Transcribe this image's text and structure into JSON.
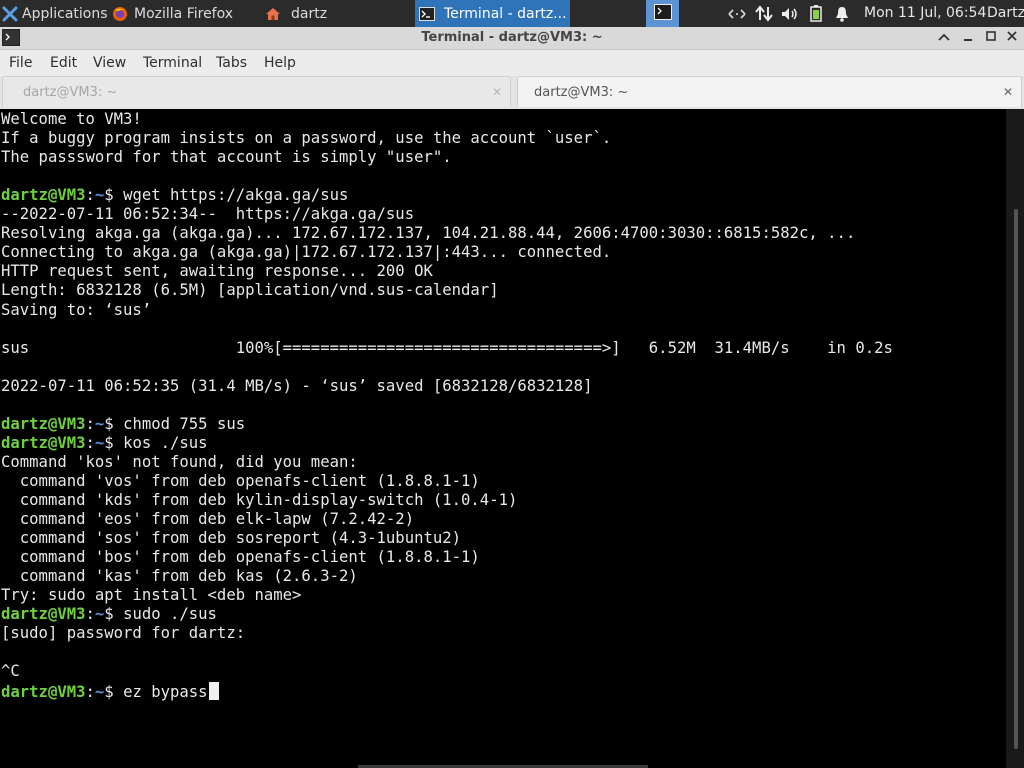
{
  "panel": {
    "applications_label": "Applications",
    "tasks": [
      {
        "label": "Mozilla Firefox",
        "icon": "firefox-icon"
      },
      {
        "label": "dartz",
        "icon": "home-folder-icon"
      },
      {
        "label": "Terminal - dartz...",
        "icon": "terminal-icon",
        "active": true
      }
    ],
    "clock": "Mon 11 Jul, 06:54",
    "user": "Dartz"
  },
  "window": {
    "title": "Terminal - dartz@VM3: ~",
    "controls": [
      "minimize",
      "maximize",
      "close"
    ]
  },
  "menu": [
    "File",
    "Edit",
    "View",
    "Terminal",
    "Tabs",
    "Help"
  ],
  "tabs": [
    {
      "label": "dartz@VM3: ~",
      "active": false
    },
    {
      "label": "dartz@VM3: ~",
      "active": true
    }
  ],
  "terminal": {
    "prompt_user": "dartz@VM3",
    "prompt_path": "~",
    "lines": [
      {
        "type": "out",
        "text": "Welcome to VM3!"
      },
      {
        "type": "out",
        "text": "If a buggy program insists on a password, use the account `user`."
      },
      {
        "type": "out",
        "text": "The passsword for that account is simply \"user\"."
      },
      {
        "type": "out",
        "text": ""
      },
      {
        "type": "cmd",
        "text": "wget https://akga.ga/sus"
      },
      {
        "type": "out",
        "text": "--2022-07-11 06:52:34--  https://akga.ga/sus"
      },
      {
        "type": "out",
        "text": "Resolving akga.ga (akga.ga)... 172.67.172.137, 104.21.88.44, 2606:4700:3030::6815:582c, ..."
      },
      {
        "type": "out",
        "text": "Connecting to akga.ga (akga.ga)|172.67.172.137|:443... connected."
      },
      {
        "type": "out",
        "text": "HTTP request sent, awaiting response... 200 OK"
      },
      {
        "type": "out",
        "text": "Length: 6832128 (6.5M) [application/vnd.sus-calendar]"
      },
      {
        "type": "out",
        "text": "Saving to: ‘sus’"
      },
      {
        "type": "out",
        "text": ""
      },
      {
        "type": "out",
        "text": "sus                      100%[==================================>]   6.52M  31.4MB/s    in 0.2s"
      },
      {
        "type": "out",
        "text": ""
      },
      {
        "type": "out",
        "text": "2022-07-11 06:52:35 (31.4 MB/s) - ‘sus’ saved [6832128/6832128]"
      },
      {
        "type": "out",
        "text": ""
      },
      {
        "type": "cmd",
        "text": "chmod 755 sus"
      },
      {
        "type": "cmd",
        "text": "kos ./sus"
      },
      {
        "type": "out",
        "text": "Command 'kos' not found, did you mean:"
      },
      {
        "type": "out",
        "text": "  command 'vos' from deb openafs-client (1.8.8.1-1)"
      },
      {
        "type": "out",
        "text": "  command 'kds' from deb kylin-display-switch (1.0.4-1)"
      },
      {
        "type": "out",
        "text": "  command 'eos' from deb elk-lapw (7.2.42-2)"
      },
      {
        "type": "out",
        "text": "  command 'sos' from deb sosreport (4.3-1ubuntu2)"
      },
      {
        "type": "out",
        "text": "  command 'bos' from deb openafs-client (1.8.8.1-1)"
      },
      {
        "type": "out",
        "text": "  command 'kas' from deb kas (2.6.3-2)"
      },
      {
        "type": "out",
        "text": "Try: sudo apt install <deb name>"
      },
      {
        "type": "cmd",
        "text": "sudo ./sus"
      },
      {
        "type": "out",
        "text": "[sudo] password for dartz:"
      },
      {
        "type": "out",
        "text": ""
      },
      {
        "type": "out",
        "text": "^C"
      },
      {
        "type": "cmd",
        "text": "ez bypass",
        "cursor": true
      }
    ]
  }
}
